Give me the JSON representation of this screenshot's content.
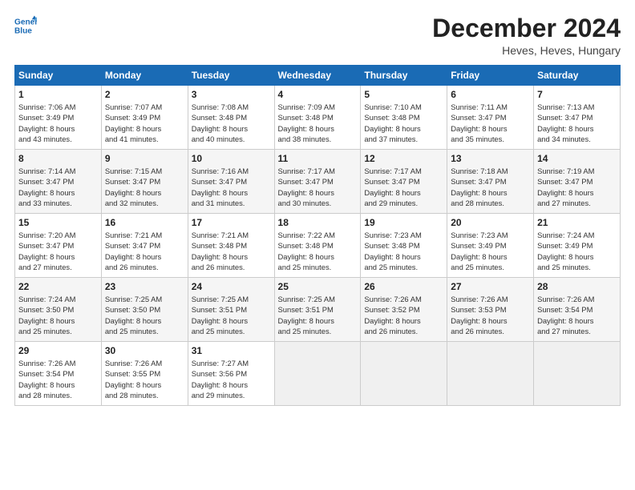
{
  "header": {
    "logo_line1": "General",
    "logo_line2": "Blue",
    "month": "December 2024",
    "location": "Heves, Heves, Hungary"
  },
  "days_of_week": [
    "Sunday",
    "Monday",
    "Tuesday",
    "Wednesday",
    "Thursday",
    "Friday",
    "Saturday"
  ],
  "weeks": [
    [
      {
        "day": "1",
        "lines": [
          "Sunrise: 7:06 AM",
          "Sunset: 3:49 PM",
          "Daylight: 8 hours",
          "and 43 minutes."
        ]
      },
      {
        "day": "2",
        "lines": [
          "Sunrise: 7:07 AM",
          "Sunset: 3:49 PM",
          "Daylight: 8 hours",
          "and 41 minutes."
        ]
      },
      {
        "day": "3",
        "lines": [
          "Sunrise: 7:08 AM",
          "Sunset: 3:48 PM",
          "Daylight: 8 hours",
          "and 40 minutes."
        ]
      },
      {
        "day": "4",
        "lines": [
          "Sunrise: 7:09 AM",
          "Sunset: 3:48 PM",
          "Daylight: 8 hours",
          "and 38 minutes."
        ]
      },
      {
        "day": "5",
        "lines": [
          "Sunrise: 7:10 AM",
          "Sunset: 3:48 PM",
          "Daylight: 8 hours",
          "and 37 minutes."
        ]
      },
      {
        "day": "6",
        "lines": [
          "Sunrise: 7:11 AM",
          "Sunset: 3:47 PM",
          "Daylight: 8 hours",
          "and 35 minutes."
        ]
      },
      {
        "day": "7",
        "lines": [
          "Sunrise: 7:13 AM",
          "Sunset: 3:47 PM",
          "Daylight: 8 hours",
          "and 34 minutes."
        ]
      }
    ],
    [
      {
        "day": "8",
        "lines": [
          "Sunrise: 7:14 AM",
          "Sunset: 3:47 PM",
          "Daylight: 8 hours",
          "and 33 minutes."
        ]
      },
      {
        "day": "9",
        "lines": [
          "Sunrise: 7:15 AM",
          "Sunset: 3:47 PM",
          "Daylight: 8 hours",
          "and 32 minutes."
        ]
      },
      {
        "day": "10",
        "lines": [
          "Sunrise: 7:16 AM",
          "Sunset: 3:47 PM",
          "Daylight: 8 hours",
          "and 31 minutes."
        ]
      },
      {
        "day": "11",
        "lines": [
          "Sunrise: 7:17 AM",
          "Sunset: 3:47 PM",
          "Daylight: 8 hours",
          "and 30 minutes."
        ]
      },
      {
        "day": "12",
        "lines": [
          "Sunrise: 7:17 AM",
          "Sunset: 3:47 PM",
          "Daylight: 8 hours",
          "and 29 minutes."
        ]
      },
      {
        "day": "13",
        "lines": [
          "Sunrise: 7:18 AM",
          "Sunset: 3:47 PM",
          "Daylight: 8 hours",
          "and 28 minutes."
        ]
      },
      {
        "day": "14",
        "lines": [
          "Sunrise: 7:19 AM",
          "Sunset: 3:47 PM",
          "Daylight: 8 hours",
          "and 27 minutes."
        ]
      }
    ],
    [
      {
        "day": "15",
        "lines": [
          "Sunrise: 7:20 AM",
          "Sunset: 3:47 PM",
          "Daylight: 8 hours",
          "and 27 minutes."
        ]
      },
      {
        "day": "16",
        "lines": [
          "Sunrise: 7:21 AM",
          "Sunset: 3:47 PM",
          "Daylight: 8 hours",
          "and 26 minutes."
        ]
      },
      {
        "day": "17",
        "lines": [
          "Sunrise: 7:21 AM",
          "Sunset: 3:48 PM",
          "Daylight: 8 hours",
          "and 26 minutes."
        ]
      },
      {
        "day": "18",
        "lines": [
          "Sunrise: 7:22 AM",
          "Sunset: 3:48 PM",
          "Daylight: 8 hours",
          "and 25 minutes."
        ]
      },
      {
        "day": "19",
        "lines": [
          "Sunrise: 7:23 AM",
          "Sunset: 3:48 PM",
          "Daylight: 8 hours",
          "and 25 minutes."
        ]
      },
      {
        "day": "20",
        "lines": [
          "Sunrise: 7:23 AM",
          "Sunset: 3:49 PM",
          "Daylight: 8 hours",
          "and 25 minutes."
        ]
      },
      {
        "day": "21",
        "lines": [
          "Sunrise: 7:24 AM",
          "Sunset: 3:49 PM",
          "Daylight: 8 hours",
          "and 25 minutes."
        ]
      }
    ],
    [
      {
        "day": "22",
        "lines": [
          "Sunrise: 7:24 AM",
          "Sunset: 3:50 PM",
          "Daylight: 8 hours",
          "and 25 minutes."
        ]
      },
      {
        "day": "23",
        "lines": [
          "Sunrise: 7:25 AM",
          "Sunset: 3:50 PM",
          "Daylight: 8 hours",
          "and 25 minutes."
        ]
      },
      {
        "day": "24",
        "lines": [
          "Sunrise: 7:25 AM",
          "Sunset: 3:51 PM",
          "Daylight: 8 hours",
          "and 25 minutes."
        ]
      },
      {
        "day": "25",
        "lines": [
          "Sunrise: 7:25 AM",
          "Sunset: 3:51 PM",
          "Daylight: 8 hours",
          "and 25 minutes."
        ]
      },
      {
        "day": "26",
        "lines": [
          "Sunrise: 7:26 AM",
          "Sunset: 3:52 PM",
          "Daylight: 8 hours",
          "and 26 minutes."
        ]
      },
      {
        "day": "27",
        "lines": [
          "Sunrise: 7:26 AM",
          "Sunset: 3:53 PM",
          "Daylight: 8 hours",
          "and 26 minutes."
        ]
      },
      {
        "day": "28",
        "lines": [
          "Sunrise: 7:26 AM",
          "Sunset: 3:54 PM",
          "Daylight: 8 hours",
          "and 27 minutes."
        ]
      }
    ],
    [
      {
        "day": "29",
        "lines": [
          "Sunrise: 7:26 AM",
          "Sunset: 3:54 PM",
          "Daylight: 8 hours",
          "and 28 minutes."
        ]
      },
      {
        "day": "30",
        "lines": [
          "Sunrise: 7:26 AM",
          "Sunset: 3:55 PM",
          "Daylight: 8 hours",
          "and 28 minutes."
        ]
      },
      {
        "day": "31",
        "lines": [
          "Sunrise: 7:27 AM",
          "Sunset: 3:56 PM",
          "Daylight: 8 hours",
          "and 29 minutes."
        ]
      },
      {
        "day": "",
        "lines": []
      },
      {
        "day": "",
        "lines": []
      },
      {
        "day": "",
        "lines": []
      },
      {
        "day": "",
        "lines": []
      }
    ]
  ]
}
